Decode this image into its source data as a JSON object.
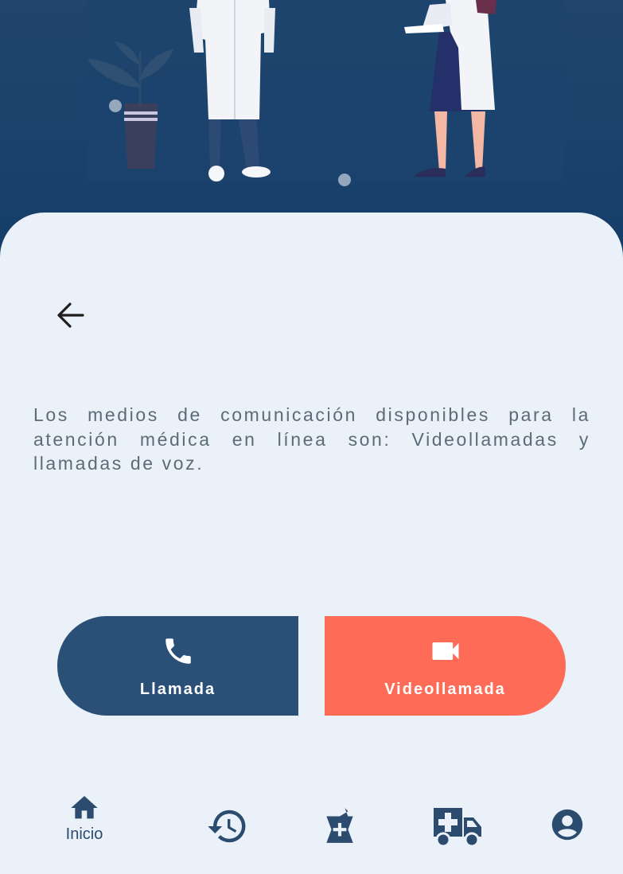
{
  "description": "Los medios de comunicación disponibles para la atención médica en línea son: Videollamadas y llamadas de voz.",
  "actions": {
    "call_label": "Llamada",
    "video_label": "Videollamada"
  },
  "bottom_nav": {
    "home_label": "Inicio",
    "items": [
      "home-icon",
      "history-icon",
      "pharmacy-icon",
      "ambulance-icon",
      "account-icon"
    ]
  },
  "colors": {
    "hero_background": "#1a416c",
    "card_background": "#eaf1f8",
    "call_button": "#2b5078",
    "video_button": "#fe6b57",
    "nav_icon": "#2b4b6f"
  }
}
